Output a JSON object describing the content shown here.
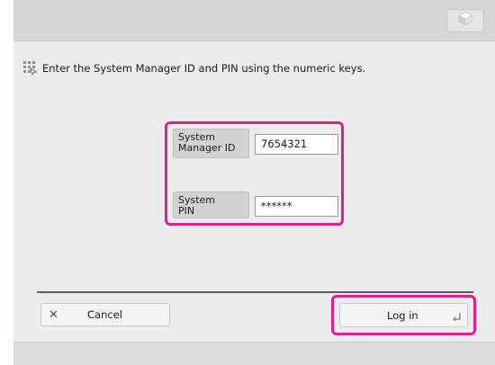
{
  "header": {
    "corner_icon": "cube-icon"
  },
  "instruction": {
    "icon": "keypad-icon",
    "text": "Enter the System Manager ID and PIN using the numeric keys."
  },
  "form": {
    "manager_id": {
      "label_line1": "System",
      "label_line2": "Manager ID",
      "value": "7654321"
    },
    "pin": {
      "label_line1": "System",
      "label_line2": "PIN",
      "value": "******"
    }
  },
  "footer": {
    "cancel_label": "Cancel",
    "cancel_icon": "close-icon",
    "login_label": "Log in",
    "login_icon": "enter-corner-icon"
  },
  "colors": {
    "highlight": "#e0218a",
    "screen_bg": "#dcdcdc",
    "panel_bg": "#ececec"
  }
}
